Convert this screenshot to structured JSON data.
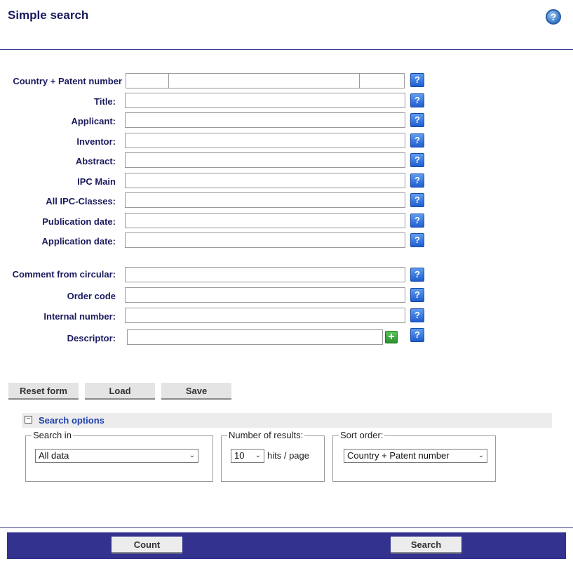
{
  "header": {
    "title": "Simple search",
    "help_icon": "?"
  },
  "form": {
    "rows": [
      {
        "label": "Country + Patent number"
      },
      {
        "label": "Title:"
      },
      {
        "label": "Applicant:"
      },
      {
        "label": "Inventor:"
      },
      {
        "label": "Abstract:"
      },
      {
        "label": "IPC Main"
      },
      {
        "label": "All IPC-Classes:"
      },
      {
        "label": "Publication date:"
      },
      {
        "label": "Application date:"
      },
      {
        "label": "Comment from circular:"
      },
      {
        "label": "Order code"
      },
      {
        "label": "Internal number:"
      },
      {
        "label": "Descriptor:"
      }
    ],
    "help_glyph": "?",
    "add_glyph": "+"
  },
  "buttons": {
    "reset": "Reset form",
    "load": "Load",
    "save": "Save"
  },
  "search_options": {
    "title": "Search options",
    "toggle": "−",
    "search_in": {
      "legend": "Search in",
      "value": "All data"
    },
    "number_of_results": {
      "legend": "Number of results:",
      "value": "10",
      "suffix": "hits / page"
    },
    "sort_order": {
      "legend": "Sort order:",
      "value": "Country + Patent number"
    }
  },
  "footer": {
    "count": "Count",
    "search": "Search"
  },
  "icons": {
    "help": "help-circle-icon",
    "field_help": "question-icon",
    "add": "plus-icon",
    "dropdown": "chevron-down-icon"
  },
  "colors": {
    "accent": "#33338f",
    "label": "#1a1a5e",
    "link": "#1f3fae"
  }
}
